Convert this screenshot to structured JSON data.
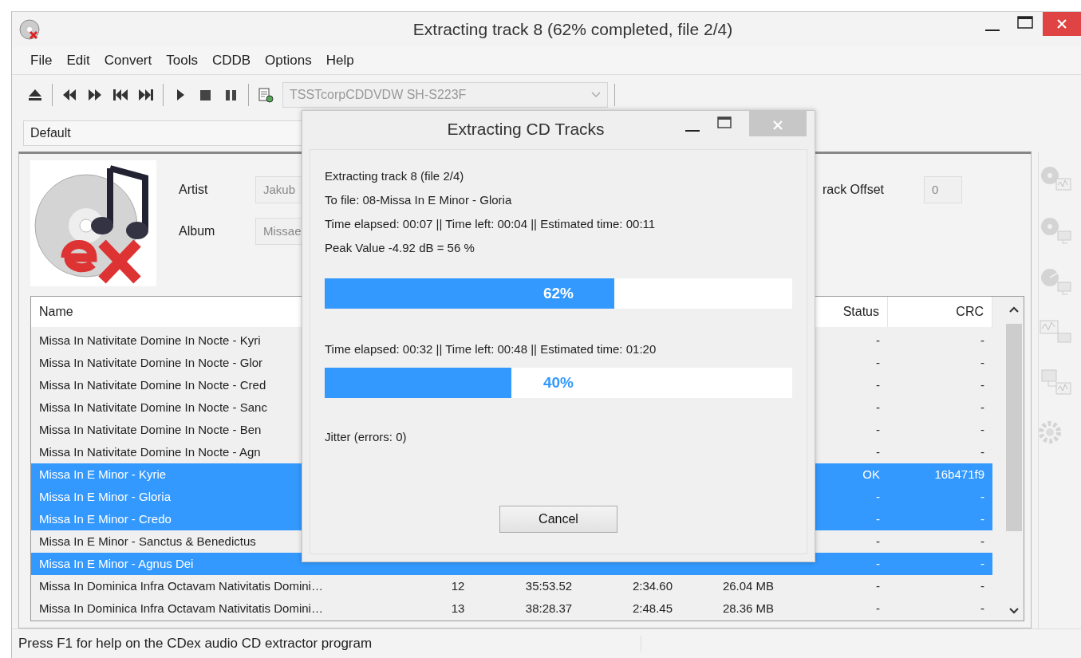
{
  "window": {
    "title": "Extracting track 8 (62% completed, file 2/4)"
  },
  "menu": [
    "File",
    "Edit",
    "Convert",
    "Tools",
    "CDDB",
    "Options",
    "Help"
  ],
  "toolbar": {
    "drive": {
      "value": "TSSTcorpCDDVDW SH-S223F",
      "disabled": true
    }
  },
  "profile": {
    "value": "Default"
  },
  "album_info": {
    "fields": [
      {
        "label": "Artist",
        "value": "Jakub"
      },
      {
        "label": "Album",
        "value": "Missae"
      }
    ],
    "offset": {
      "label": "rack Offset",
      "value": "0"
    }
  },
  "table": {
    "columns": [
      "Name",
      "Status",
      "CRC"
    ],
    "rows": [
      {
        "name": "Missa In Nativitate Domine In Nocte - Kyri",
        "status": "-",
        "crc": "-",
        "selected": false
      },
      {
        "name": "Missa In Nativitate Domine In Nocte - Glor",
        "status": "-",
        "crc": "-",
        "selected": false
      },
      {
        "name": "Missa In Nativitate Domine In Nocte - Cred",
        "status": "-",
        "crc": "-",
        "selected": false
      },
      {
        "name": "Missa In Nativitate Domine In Nocte - Sanc",
        "status": "-",
        "crc": "-",
        "selected": false
      },
      {
        "name": "Missa In Nativitate Domine In Nocte - Ben",
        "status": "-",
        "crc": "-",
        "selected": false
      },
      {
        "name": "Missa In Nativitate Domine In Nocte - Agn",
        "status": "-",
        "crc": "-",
        "selected": false
      },
      {
        "name": "Missa In E Minor - Kyrie",
        "status": "OK",
        "crc": "16b471f9",
        "selected": true
      },
      {
        "name": "Missa In E Minor - Gloria",
        "status": "-",
        "crc": "-",
        "selected": true
      },
      {
        "name": "Missa In E Minor - Credo",
        "status": "-",
        "crc": "-",
        "selected": true
      },
      {
        "name": "Missa In E Minor - Sanctus & Benedictus",
        "status": "-",
        "crc": "-",
        "selected": false
      },
      {
        "name": "Missa In E Minor - Agnus Dei",
        "status": "-",
        "crc": "-",
        "selected": true
      },
      {
        "name": "Missa In Dominica Infra Octavam Nativitatis Domini…",
        "track": "12",
        "start": "35:53.52",
        "length": "2:34.60",
        "size": "26.04 MB",
        "status": "-",
        "crc": "-",
        "selected": false
      },
      {
        "name": "Missa In Dominica Infra Octavam Nativitatis Domini…",
        "track": "13",
        "start": "38:28.37",
        "length": "2:48.45",
        "size": "28.36 MB",
        "status": "-",
        "crc": "-",
        "selected": false
      }
    ]
  },
  "side_tools": [
    {
      "disabled": true
    },
    {
      "disabled": true
    },
    {
      "disabled": true
    },
    {
      "disabled": true
    },
    {
      "disabled": true
    },
    {
      "disabled": true
    }
  ],
  "status_bar": {
    "text": "Press F1 for help on the CDex audio CD extractor program"
  },
  "dialog": {
    "title": "Extracting CD Tracks",
    "lines": [
      "Extracting track 8 (file 2/4)",
      "To file: 08-Missa In E Minor - Gloria",
      "Time elapsed: 00:07 || Time left: 00:04 || Estimated time: 00:11",
      "Peak Value -4.92 dB =  56 %"
    ],
    "track_progress": {
      "level": 0.62,
      "label": "62%"
    },
    "total_time": "Time elapsed: 00:32 || Time left: 00:48 || Estimated time: 01:20",
    "total_progress": {
      "level": 0.4,
      "label": "40%"
    },
    "jitter": "Jitter (errors: 0)",
    "buttons": [
      "Cancel"
    ]
  }
}
